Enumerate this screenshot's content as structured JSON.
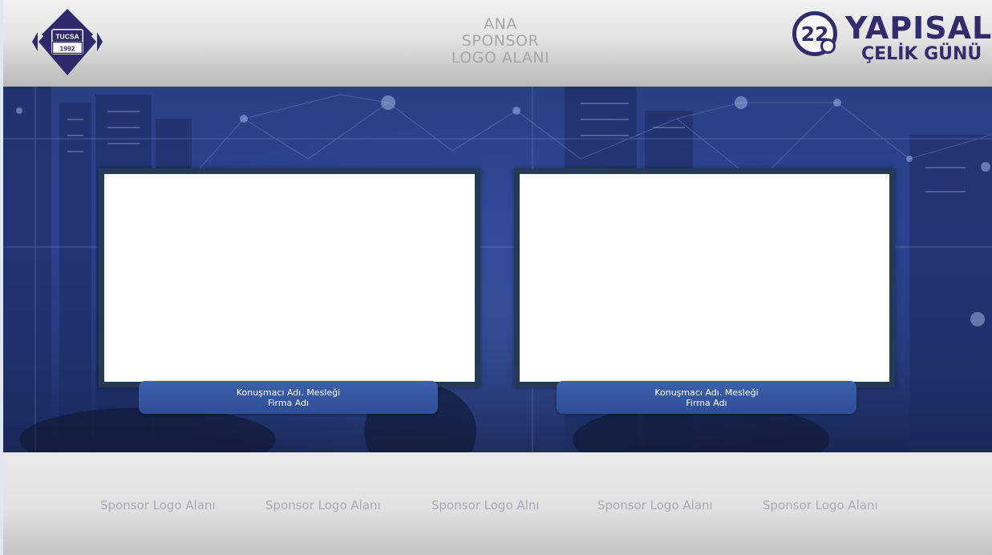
{
  "header": {
    "left_logo": {
      "top_text": "TUCSA",
      "bottom_text": "1992"
    },
    "main_sponsor_lines": [
      "ANA",
      "SPONSOR",
      "LOGO ALANI"
    ],
    "event_logo": {
      "number": "22",
      "title_line1": "YAPISAL",
      "title_line2": "ÇELİK GÜNÜ"
    }
  },
  "panels": [
    {
      "caption_line1": "Konuşmacı Adı. Mesleği",
      "caption_line2": "Firma Adı"
    },
    {
      "caption_line1": "Konuşmacı Adı. Mesleği",
      "caption_line2": "Firma Adı"
    }
  ],
  "footer": {
    "sponsors": [
      "Sponsor Logo Alanı",
      "Sponsor Logo Alanı",
      "Sponsor Logo Alnı",
      "Sponsor Logo Alanı",
      "Sponsor Logo Alanı"
    ]
  },
  "colors": {
    "brand_navy": "#322c6c",
    "stage_blue": "#2c4290",
    "caption_blue": "#3c60a9",
    "screen_border": "#243a55",
    "placeholder_gray": "#a6a6a6"
  }
}
